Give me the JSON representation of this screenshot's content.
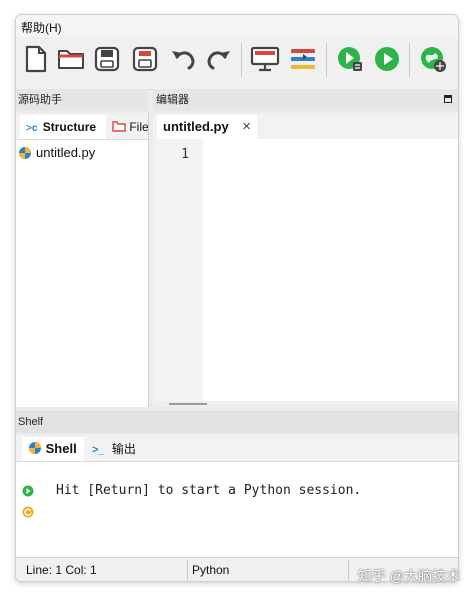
{
  "menubar": {
    "help_label": "帮助(H)"
  },
  "toolbar": {
    "buttons": [
      {
        "icon": "new-file-icon"
      },
      {
        "icon": "open-folder-icon"
      },
      {
        "icon": "save-icon"
      },
      {
        "icon": "save-as-icon"
      },
      {
        "icon": "undo-icon"
      },
      {
        "icon": "redo-icon"
      },
      {
        "icon": "display-icon"
      },
      {
        "icon": "toggle-panels-icon"
      },
      {
        "icon": "run-script-icon"
      },
      {
        "icon": "run-icon"
      },
      {
        "icon": "globe-icon"
      }
    ]
  },
  "left_panel": {
    "title": "源码助手",
    "tabs": [
      {
        "label": "Structure",
        "prefix": ">c",
        "active": true
      },
      {
        "label": "File",
        "active": false
      }
    ],
    "tree": [
      {
        "label": "untitled.py"
      }
    ]
  },
  "editor_panel": {
    "title": "编辑器",
    "tabs": [
      {
        "label": "untitled.py",
        "close": "×",
        "active": true
      }
    ],
    "lines": [
      "1"
    ]
  },
  "shelf_panel": {
    "title": "Shelf",
    "tabs": [
      {
        "label": "Shell",
        "active": true
      },
      {
        "label": "输出",
        "active": false
      }
    ],
    "console": [
      {
        "text": "Hit [Return] to start a Python session."
      }
    ]
  },
  "statusbar": {
    "position": "Line: 1 Col: 1",
    "language": "Python"
  },
  "watermark": "知乎 @大脑技术",
  "colors": {
    "run_green": "#2db34a",
    "accent_red": "#d9463f",
    "accent_blue": "#2f7fd1",
    "accent_yellow": "#f2b630"
  }
}
